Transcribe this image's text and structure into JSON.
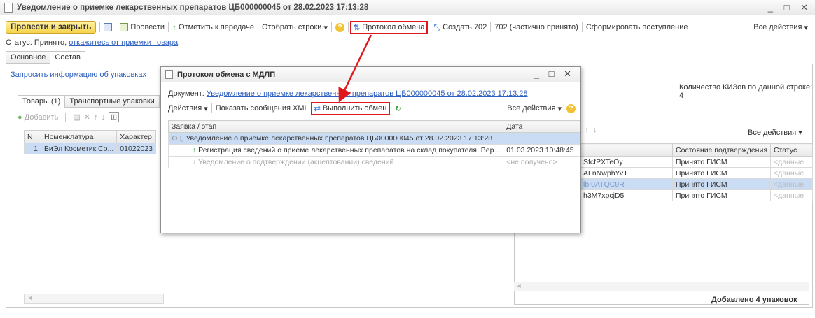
{
  "window": {
    "title": "Уведомление о приемке лекарственных препаратов ЦБ000000045 от 28.02.2023 17:13:28",
    "controls": "_ □ ✕"
  },
  "toolbar": {
    "post_close": "Провести и закрыть",
    "post": "Провести",
    "mark_transfer": "Отметить к передаче",
    "select_rows": "Отобрать строки",
    "exchange_protocol": "Протокол обмена",
    "create702": "Создать 702",
    "partial702": "702 (частично принято)",
    "form_receipt": "Сформировать поступление",
    "all_actions": "Все действия"
  },
  "status": {
    "prefix": "Статус: Принято,",
    "link": "откажитесь от приемки товара"
  },
  "tabs": [
    "Основное",
    "Состав"
  ],
  "left": {
    "request_link": "Запросить информацию об упаковках",
    "tabs": [
      "Товары (1)",
      "Транспортные упаковки"
    ],
    "add": "Добавить",
    "columns": [
      "N",
      "Номенклатура",
      "Характер"
    ],
    "rows": [
      {
        "n": "1",
        "name": "БиЭл Косметик Co...",
        "char": "01022023"
      }
    ]
  },
  "right": {
    "kiz_label": "Количество КИЗов по данной строке: 4",
    "all_actions": "Все действия",
    "columns": [
      "",
      "Состояние подтверждения",
      "Статус"
    ],
    "rows": [
      {
        "code": "SfcfPXTeOy",
        "state": "Принято ГИСМ",
        "status": "<данные"
      },
      {
        "code": "ALnNwphYvT",
        "state": "Принято ГИСМ",
        "status": "<данные"
      },
      {
        "code": "lbI0ATQC9R",
        "state": "Принято ГИСМ",
        "status": "<данные"
      },
      {
        "code": "h3M7xpcjD5",
        "state": "Принято ГИСМ",
        "status": "<данные"
      }
    ],
    "added": "Добавлено 4 упаковок"
  },
  "modal": {
    "title": "Протокол обмена с МДЛП",
    "controls": "_ □ ✕",
    "doc_prefix": "Документ:",
    "doc_link": "Уведомление о приемке лекарственных препаратов ЦБ000000045 от 28.02.2023 17:13:28",
    "actions": "Действия",
    "show_xml": "Показать сообщения XML",
    "run_exchange": "Выполнить обмен",
    "all_actions": "Все действия",
    "columns": [
      "Заявка / этап",
      "Дата"
    ],
    "rows": [
      {
        "stage": "Уведомление о приемке лекарственных препаратов ЦБ000000045 от 28.02.2023 17:13:28",
        "date": ""
      },
      {
        "stage": "Регистрация сведений о приеме лекарственных препаратов на склад покупателя, Вер...",
        "date": "01.03.2023 10:48:45"
      },
      {
        "stage": "Уведомление о подтверждении (акцептовании) сведений",
        "date": "<не получено>"
      }
    ]
  },
  "colors": {
    "highlight": "#e0181e",
    "selection": "#c9dcf3",
    "link": "#3060c0",
    "primary_button": "#f5d44c"
  }
}
